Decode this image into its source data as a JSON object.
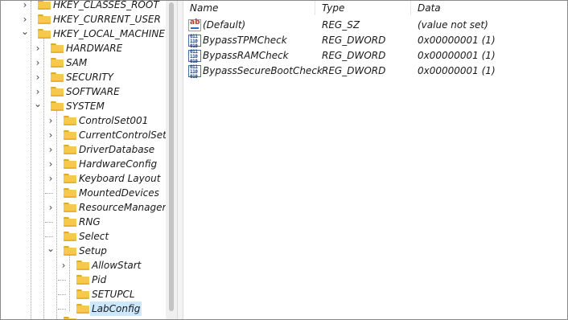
{
  "tree": {
    "items": [
      {
        "label": "HKEY_CLASSES_ROOT",
        "level": 1,
        "chevron": "right"
      },
      {
        "label": "HKEY_CURRENT_USER",
        "level": 1,
        "chevron": "right"
      },
      {
        "label": "HKEY_LOCAL_MACHINE",
        "level": 1,
        "chevron": "down"
      },
      {
        "label": "HARDWARE",
        "level": 2,
        "chevron": "right"
      },
      {
        "label": "SAM",
        "level": 2,
        "chevron": "right"
      },
      {
        "label": "SECURITY",
        "level": 2,
        "chevron": "right"
      },
      {
        "label": "SOFTWARE",
        "level": 2,
        "chevron": "right"
      },
      {
        "label": "SYSTEM",
        "level": 2,
        "chevron": "down"
      },
      {
        "label": "ControlSet001",
        "level": 3,
        "chevron": "right"
      },
      {
        "label": "CurrentControlSet",
        "level": 3,
        "chevron": "right"
      },
      {
        "label": "DriverDatabase",
        "level": 3,
        "chevron": "right"
      },
      {
        "label": "HardwareConfig",
        "level": 3,
        "chevron": "right"
      },
      {
        "label": "Keyboard Layout",
        "level": 3,
        "chevron": "right"
      },
      {
        "label": "MountedDevices",
        "level": 3,
        "chevron": "none"
      },
      {
        "label": "ResourceManager",
        "level": 3,
        "chevron": "right"
      },
      {
        "label": "RNG",
        "level": 3,
        "chevron": "none"
      },
      {
        "label": "Select",
        "level": 3,
        "chevron": "none"
      },
      {
        "label": "Setup",
        "level": 3,
        "chevron": "down"
      },
      {
        "label": "AllowStart",
        "level": 4,
        "chevron": "right"
      },
      {
        "label": "Pid",
        "level": 4,
        "chevron": "none"
      },
      {
        "label": "SETUPCL",
        "level": 4,
        "chevron": "none"
      },
      {
        "label": "LabConfig",
        "level": 4,
        "chevron": "none",
        "selected": true
      }
    ]
  },
  "values": {
    "columns": {
      "name": "Name",
      "type": "Type",
      "data": "Data"
    },
    "rows": [
      {
        "icon": "string-value-icon",
        "name": "(Default)",
        "type": "REG_SZ",
        "data": "(value not set)"
      },
      {
        "icon": "dword-value-icon",
        "name": "BypassTPMCheck",
        "type": "REG_DWORD",
        "data": "0x00000001 (1)"
      },
      {
        "icon": "dword-value-icon",
        "name": "BypassRAMCheck",
        "type": "REG_DWORD",
        "data": "0x00000001 (1)"
      },
      {
        "icon": "dword-value-icon",
        "name": "BypassSecureBootCheck",
        "type": "REG_DWORD",
        "data": "0x00000001 (1)"
      }
    ]
  },
  "colors": {
    "selection": "#cce8ff",
    "folder": "#f6c94b"
  }
}
